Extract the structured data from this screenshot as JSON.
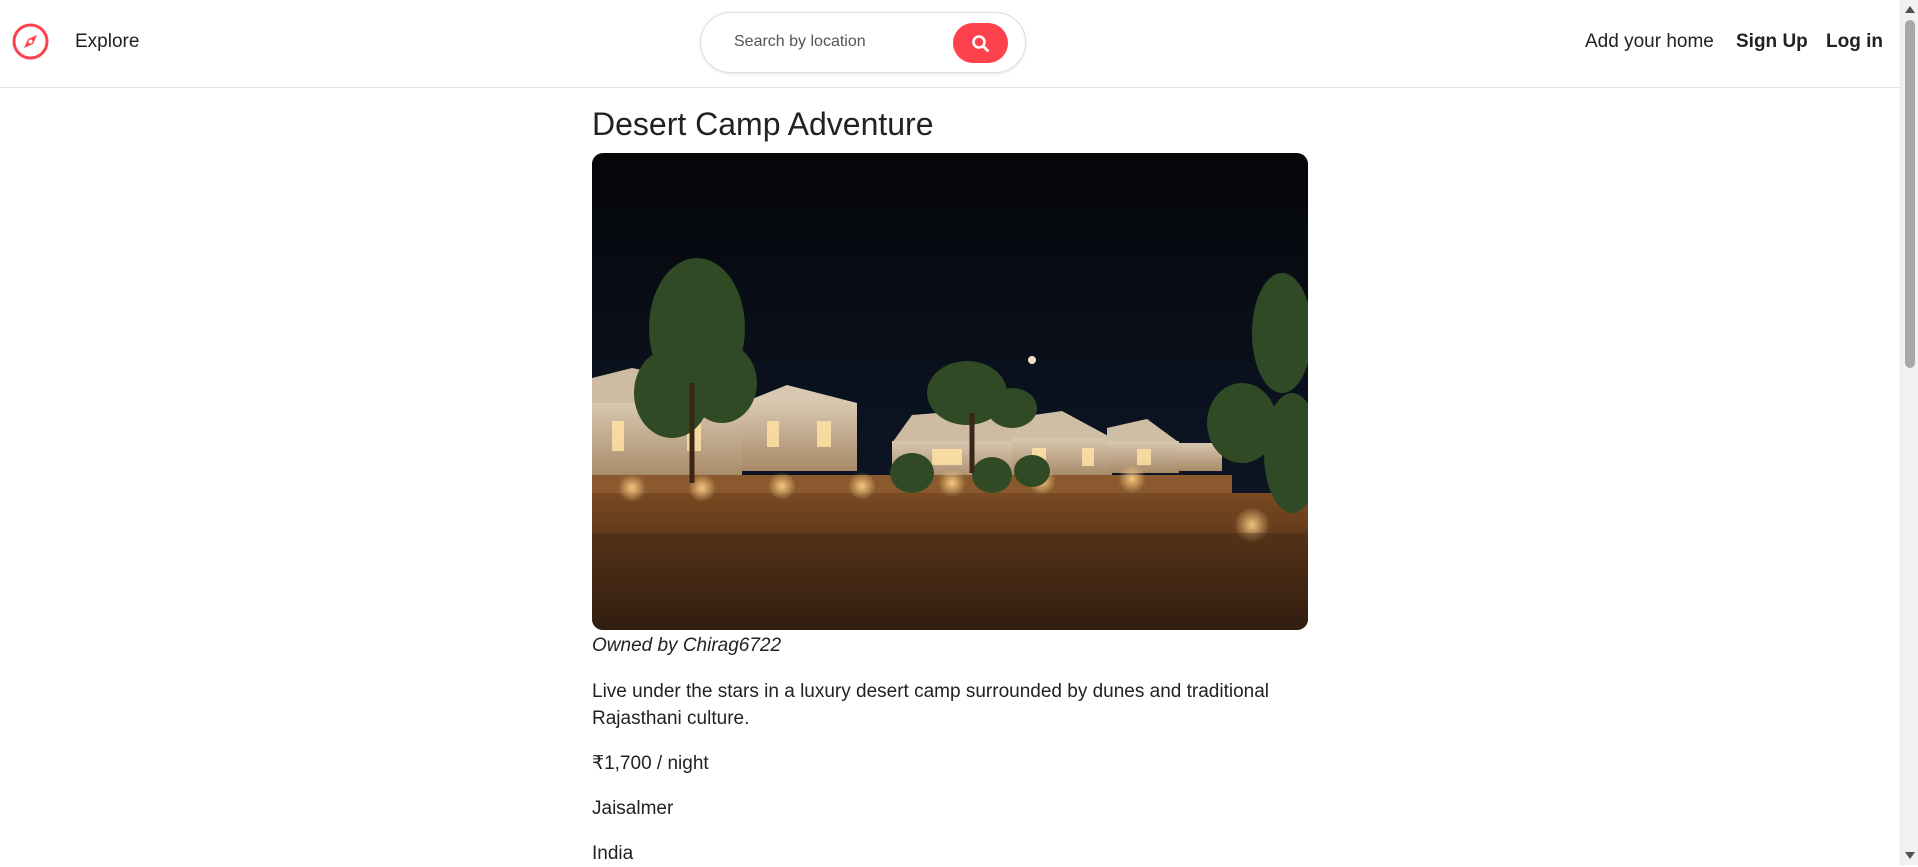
{
  "navbar": {
    "brand_icon": "compass-icon",
    "explore_label": "Explore",
    "search": {
      "placeholder": "Search by location",
      "value": "",
      "button_icon": "search-icon"
    },
    "add_home_label": "Add your home",
    "signup_label": "Sign Up",
    "login_label": "Log in"
  },
  "listing": {
    "title": "Desert Camp Adventure",
    "image_alt": "Desert camp tents at night",
    "owner": "Owned by Chirag6722",
    "description": "Live under the stars in a luxury desert camp surrounded by dunes and traditional Rajasthani culture.",
    "price": "₹1,700 / night",
    "location": "Jaisalmer",
    "country": "India"
  },
  "colors": {
    "brand": "#fe424d",
    "text": "#222222",
    "border": "#dddddd"
  }
}
